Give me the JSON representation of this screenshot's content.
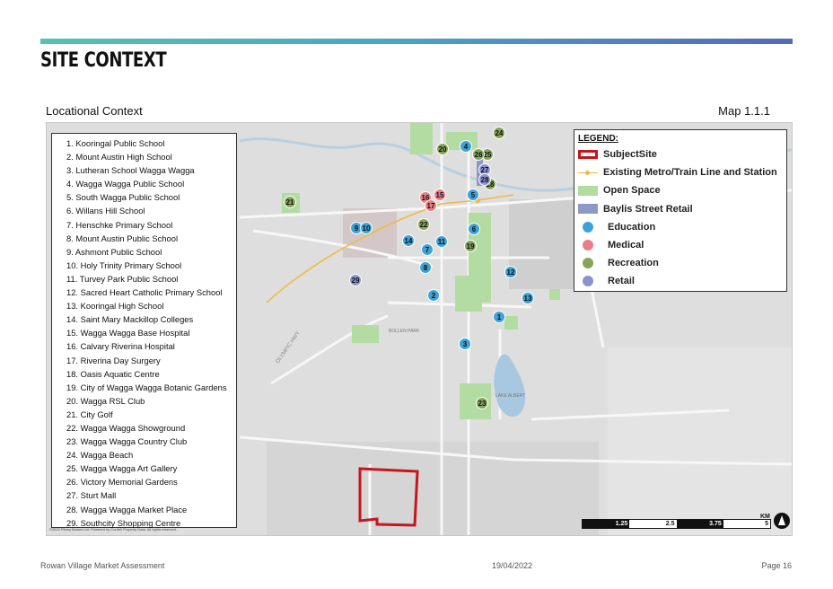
{
  "header": {
    "title": "SITE CONTEXT",
    "subtitle": "Locational Context",
    "map_ref": "Map 1.1.1"
  },
  "poi_list": [
    "1. Kooringal Public School",
    "2. Mount Austin High School",
    "3. Lutheran School Wagga Wagga",
    "4. Wagga Wagga Public School",
    "5. South Wagga Public School",
    "6. Willans Hill School",
    "7. Henschke Primary School",
    "8. Mount Austin Public School",
    "9. Ashmont Public School",
    "10. Holy Trinity Primary School",
    "11. Turvey Park Public School",
    "12. Sacred Heart Catholic Primary School",
    "13. Kooringal High School",
    "14. Saint Mary Mackillop Colleges",
    "15. Wagga Wagga Base Hospital",
    "16. Calvary Riverina Hospital",
    "17. Riverina Day Surgery",
    "18. Oasis Aquatic Centre",
    "19. City of Wagga Wagga Botanic Gardens",
    "20. Wagga RSL Club",
    "21. City Golf",
    "22. Wagga Wagga Showground",
    "23. Wagga Wagga Country Club",
    "24. Wagga Beach",
    "25. Wagga Wagga Art Gallery",
    "26. Victory Memorial Gardens",
    "27. Sturt Mall",
    "28. Wagga Wagga Market Place",
    "29. Southcity Shopping Centre"
  ],
  "legend": {
    "title": "LEGEND:",
    "items": [
      {
        "label": "SubjectSite",
        "swatch": "site",
        "color": "#c4161c"
      },
      {
        "label": "Existing Metro/Train Line and Station",
        "swatch": "rail",
        "color": "#f0b93c"
      },
      {
        "label": "Open Space",
        "swatch": "open",
        "color": "#b3dca2"
      },
      {
        "label": "Baylis Street Retail",
        "swatch": "retail",
        "color": "#8e98c5"
      },
      {
        "label": "Education",
        "swatch": "dot",
        "color": "#3ea2d6"
      },
      {
        "label": "Medical",
        "swatch": "dot",
        "color": "#ea7e86"
      },
      {
        "label": "Recreation",
        "swatch": "dot",
        "color": "#86a55a"
      },
      {
        "label": "Retail",
        "swatch": "dot",
        "color": "#8a93cf"
      }
    ]
  },
  "markers": [
    {
      "label": "1",
      "category": "Education"
    },
    {
      "label": "2",
      "category": "Education"
    },
    {
      "label": "3",
      "category": "Education"
    },
    {
      "label": "4",
      "category": "Education"
    },
    {
      "label": "5",
      "category": "Education"
    },
    {
      "label": "6",
      "category": "Education"
    },
    {
      "label": "7",
      "category": "Education"
    },
    {
      "label": "8",
      "category": "Education"
    },
    {
      "label": "9",
      "category": "Education"
    },
    {
      "label": "10",
      "category": "Education"
    },
    {
      "label": "11",
      "category": "Education"
    },
    {
      "label": "12",
      "category": "Education"
    },
    {
      "label": "13",
      "category": "Education"
    },
    {
      "label": "14",
      "category": "Education"
    },
    {
      "label": "15",
      "category": "Medical"
    },
    {
      "label": "16",
      "category": "Medical"
    },
    {
      "label": "17",
      "category": "Medical"
    },
    {
      "label": "18",
      "category": "Recreation"
    },
    {
      "label": "19",
      "category": "Recreation"
    },
    {
      "label": "20",
      "category": "Recreation"
    },
    {
      "label": "21",
      "category": "Recreation"
    },
    {
      "label": "22",
      "category": "Recreation"
    },
    {
      "label": "23",
      "category": "Recreation"
    },
    {
      "label": "24",
      "category": "Recreation"
    },
    {
      "label": "25",
      "category": "Recreation"
    },
    {
      "label": "26",
      "category": "Recreation"
    },
    {
      "label": "27",
      "category": "Retail"
    },
    {
      "label": "28",
      "category": "Retail"
    },
    {
      "label": "29",
      "category": "Retail"
    }
  ],
  "map_labels": {
    "park": "BOLLEN PARK",
    "lake": "LAKE ALBERT",
    "highway": "OLYMPIC HWY"
  },
  "scale": {
    "unit": "KM",
    "ticks": [
      "1.25",
      "2.5",
      "3.75",
      "5"
    ]
  },
  "attribution": "©2022 Pitney Bowes Ltd. Powered by Cordell Property Data. All rights reserved.",
  "footer": {
    "left": "Rowan Village Market Assessment",
    "center": "19/04/2022",
    "right": "Page 16"
  }
}
